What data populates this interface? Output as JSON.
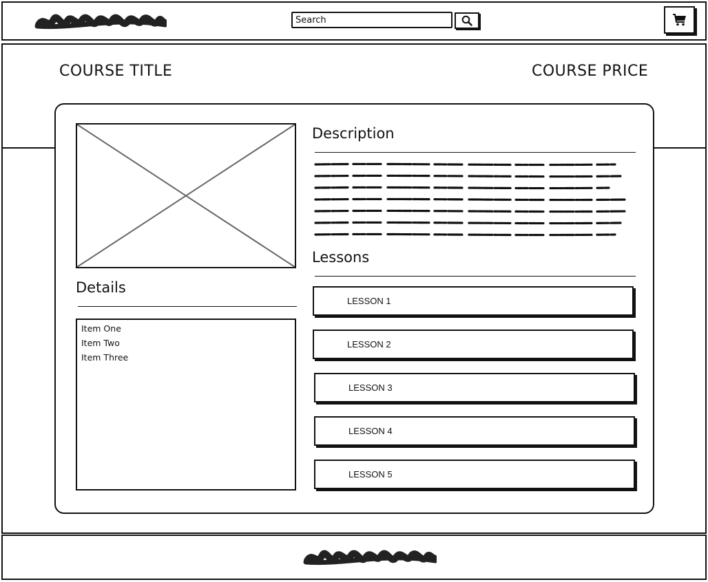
{
  "header": {
    "search": {
      "placeholder": "Search"
    }
  },
  "course": {
    "title": "COURSE TITLE",
    "price": "COURSE PRICE"
  },
  "details": {
    "heading": "Details",
    "items": [
      "Item One",
      "Item Two",
      "Item Three"
    ]
  },
  "description": {
    "heading": "Description"
  },
  "lessons": {
    "heading": "Lessons",
    "items": [
      "LESSON 1",
      "LESSON 2",
      "LESSON 3",
      "LESSON 4",
      "LESSON 5"
    ]
  },
  "icons": {
    "search": "search-icon",
    "cart": "shopping-cart-icon",
    "image": "image-placeholder-icon"
  },
  "colors": {
    "ink": "#111111",
    "background": "#ffffff",
    "placeholder_x": "#666666"
  }
}
